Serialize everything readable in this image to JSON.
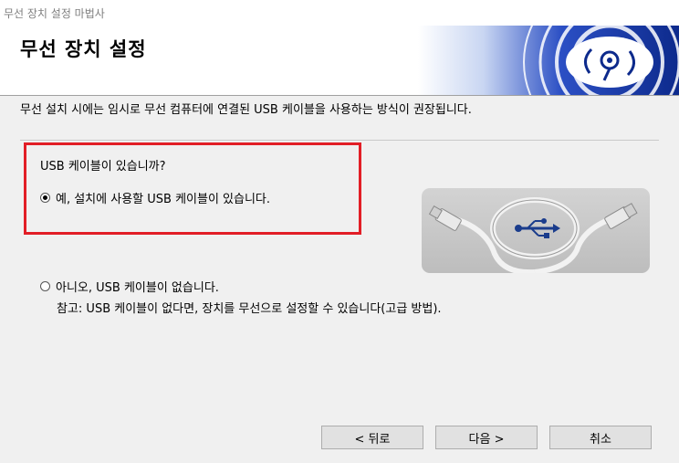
{
  "window": {
    "title": "무선 장치 설정 마법사"
  },
  "header": {
    "heading": "무선 장치 설정"
  },
  "intro": "무선 설치 시에는 임시로 무선 컴퓨터에 연결된 USB 케이블을 사용하는 방식이 권장됩니다.",
  "question": {
    "label": "USB 케이블이 있습니까?",
    "options": [
      {
        "label": "예, 설치에 사용할 USB 케이블이 있습니다.",
        "checked": true
      },
      {
        "label": "아니오, USB 케이블이 없습니다.",
        "checked": false
      }
    ],
    "note": "참고: USB 케이블이 없다면, 장치를 무선으로 설정할 수 있습니다(고급 방법)."
  },
  "buttons": {
    "back": "< 뒤로",
    "next": "다음 >",
    "cancel": "취소"
  },
  "colors": {
    "highlight_border": "#e21e26",
    "banner_blue": "#1f3fa8",
    "background": "#f0f0f0"
  },
  "icons": [
    "wireless-logo-icon",
    "usb-cable-image",
    "usb-symbol-icon"
  ]
}
